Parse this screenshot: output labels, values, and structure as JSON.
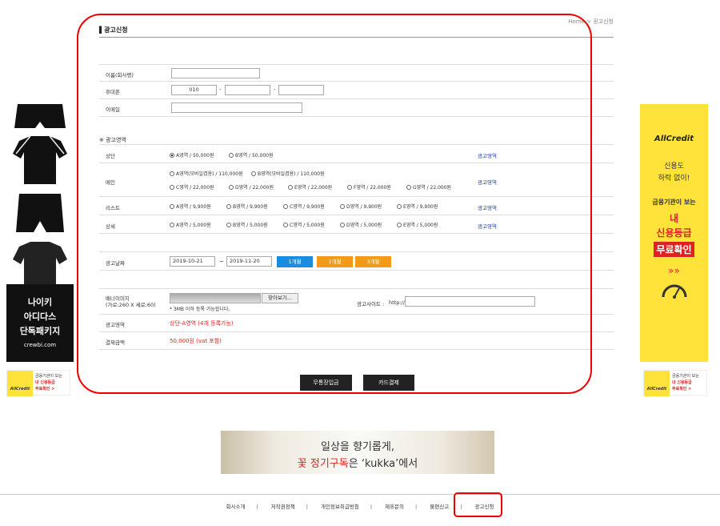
{
  "breadcrumb": "Home > 광고신청",
  "page_title": "광고신청",
  "form": {
    "name_label": "이름(회사명)",
    "phone_label": "휴대폰",
    "phone_prefix": "010",
    "email_label": "이메일",
    "section_title": "※ 광고영역",
    "rows": {
      "top": {
        "label": "상단",
        "opt1": "A영역 / 50,000원",
        "opt2": "B영역 / 50,000원",
        "link": "광고영역"
      },
      "main": {
        "label": "메인",
        "opt1": "A영역(모바일겸용) / 110,000원",
        "opt2": "B영역(모바일겸용) / 110,000원",
        "opt3": "C영역 / 22,000원",
        "opt4": "D영역 / 22,000원",
        "opt5": "E영역 / 22,000원",
        "opt6": "F영역 / 22,000원",
        "opt7": "G영역 / 22,000원",
        "link": "광고영역"
      },
      "list": {
        "label": "리스트",
        "opt1": "A영역 / 9,900원",
        "opt2": "B영역 / 9,900원",
        "opt3": "C영역 / 9,900원",
        "opt4": "D영역 / 9,900원",
        "opt5": "E영역 / 9,900원",
        "link": "광고영역"
      },
      "detail": {
        "label": "상세",
        "opt1": "A영역 / 5,000원",
        "opt2": "B영역 / 5,000원",
        "opt3": "C영역 / 5,000원",
        "opt4": "D영역 / 5,000원",
        "opt5": "E영역 / 5,000원",
        "link": "광고영역"
      }
    },
    "date_label": "광고날짜",
    "date_start": "2019-10-21",
    "date_sep": "~",
    "date_end": "2019-11-20",
    "period_1": "1개월",
    "period_2": "2개월",
    "period_3": "3개월",
    "banner_label": "배너이미지",
    "banner_size": "(가로:260 X 세로:60)",
    "browse": "찾아보기...",
    "file_note": "* 3MB 이하 등록 가능합니다.",
    "site_label": "광고사이트 :",
    "site_prefix": "http://",
    "area_label": "광고영역",
    "area_value": "상단-A영역 (4개 등록가능)",
    "amount_label": "결제금액",
    "amount_value": "50,000원 (vat 포함)"
  },
  "buttons": {
    "bank": "무통장입금",
    "card": "카드결제"
  },
  "ad_left": {
    "line1": "나이키",
    "line2": "아디다스",
    "line3": "단독패키지",
    "site": "crewbi.com"
  },
  "ad_right": {
    "brand": "AllCredit",
    "l1": "신용도",
    "l2": "하락 없이!",
    "l3": "금융기관이 보는",
    "l4": "내",
    "l5": "신용등급",
    "l6": "무료확인",
    "chev": "»»"
  },
  "mini_ad": {
    "brand": "AllCredit",
    "l1": "금융기관이 보는",
    "l2": "내 신용등급",
    "l3": "무료확인 >"
  },
  "banner": {
    "l1": "일상을 향기롭게,",
    "l2a": "꽃 정기구독",
    "l2b": "은 ‘kukka’에서"
  },
  "footer": {
    "l1": "회사소개",
    "l2": "저작권정책",
    "l3": "개인정보취급방침",
    "l4": "제휴문의",
    "l5": "불편신고",
    "l6": "광고신청",
    "sep": "|"
  },
  "colors": {
    "blue": "#1a8de0",
    "orange": "#f39a1a",
    "red": "#dd2222",
    "yellow": "#ffe33b"
  }
}
